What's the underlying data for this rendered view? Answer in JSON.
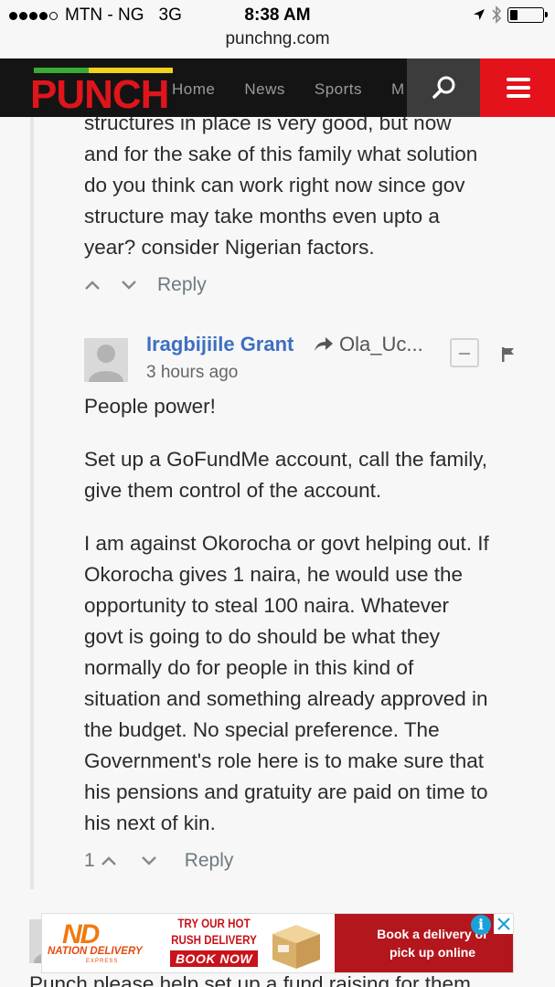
{
  "status_bar": {
    "carrier": "MTN - NG",
    "network": "3G",
    "time": "8:38 AM"
  },
  "browser": {
    "url": "punchng.com"
  },
  "header": {
    "logo_text": "PUNCH",
    "nav": [
      "Home",
      "News",
      "Sports",
      "M"
    ],
    "colors": {
      "brand_red": "#e3121b",
      "bar_green": "#3aa935",
      "bar_yellow": "#f4d21c"
    }
  },
  "previous_comment": {
    "lines": [
      "structures in place is very good, but now",
      "and for the sake of this family what solution",
      "do you think can work right now since gov",
      "structure may take months even upto a",
      "year? consider Nigerian factors."
    ],
    "reply_label": "Reply"
  },
  "comment": {
    "author": "Iragbijiile Grant",
    "reply_to": "Ola_Uc...",
    "timestamp": "3 hours ago",
    "paragraphs": [
      [
        "People power!"
      ],
      [
        "Set up a GoFundMe account, call the family,",
        "give them control of the account."
      ],
      [
        "I am against Okorocha or govt helping out. If",
        "Okorocha gives 1 naira, he would use the",
        "opportunity to steal 100 naira. Whatever",
        "govt is going to do should be what they",
        "normally do for people in this kind of",
        "situation and something already approved in",
        "the budget. No special preference. The",
        "Government's role here is to make sure that",
        "his pensions and gratuity are paid on time to",
        "his next of kin."
      ]
    ],
    "upvotes": "1",
    "reply_label": "Reply"
  },
  "next_comment": {
    "text_partial": "Punch please help set up a fund raising for them"
  },
  "ad": {
    "brand_mark": "ND",
    "brand_name": "NATION DELIVERY",
    "brand_sub": "EXPRESS",
    "headline_1": "TRY OUR HOT",
    "headline_2": "RUSH DELIVERY",
    "cta": "BOOK NOW",
    "right_text": "Book a delivery or pick up online",
    "info_icon": "i"
  }
}
